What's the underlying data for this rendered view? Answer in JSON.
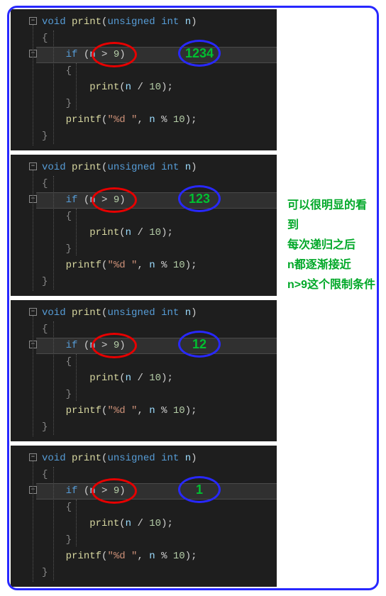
{
  "code": {
    "sig_void": "void",
    "sig_fn": "print",
    "sig_unsigned": "unsigned",
    "sig_int": "int",
    "sig_arg": "n",
    "if_kw": "if",
    "cond_n": "n",
    "cond_op": ">",
    "cond_rhs": "9",
    "call_fn": "print",
    "call_arg_n": "n",
    "call_op": "/",
    "call_rhs": "10",
    "printf_fn": "printf",
    "printf_fmt": "\"%d \"",
    "printf_arg_n": "n",
    "printf_op": "%",
    "printf_rhs": "10"
  },
  "panels": [
    {
      "value": "1234"
    },
    {
      "value": "123"
    },
    {
      "value": "12"
    },
    {
      "value": "1"
    }
  ],
  "annotation": {
    "l1": "可以很明显的看到",
    "l2": "每次递归之后",
    "l3": "n都逐渐接近",
    "l4": "n>9这个限制条件"
  }
}
